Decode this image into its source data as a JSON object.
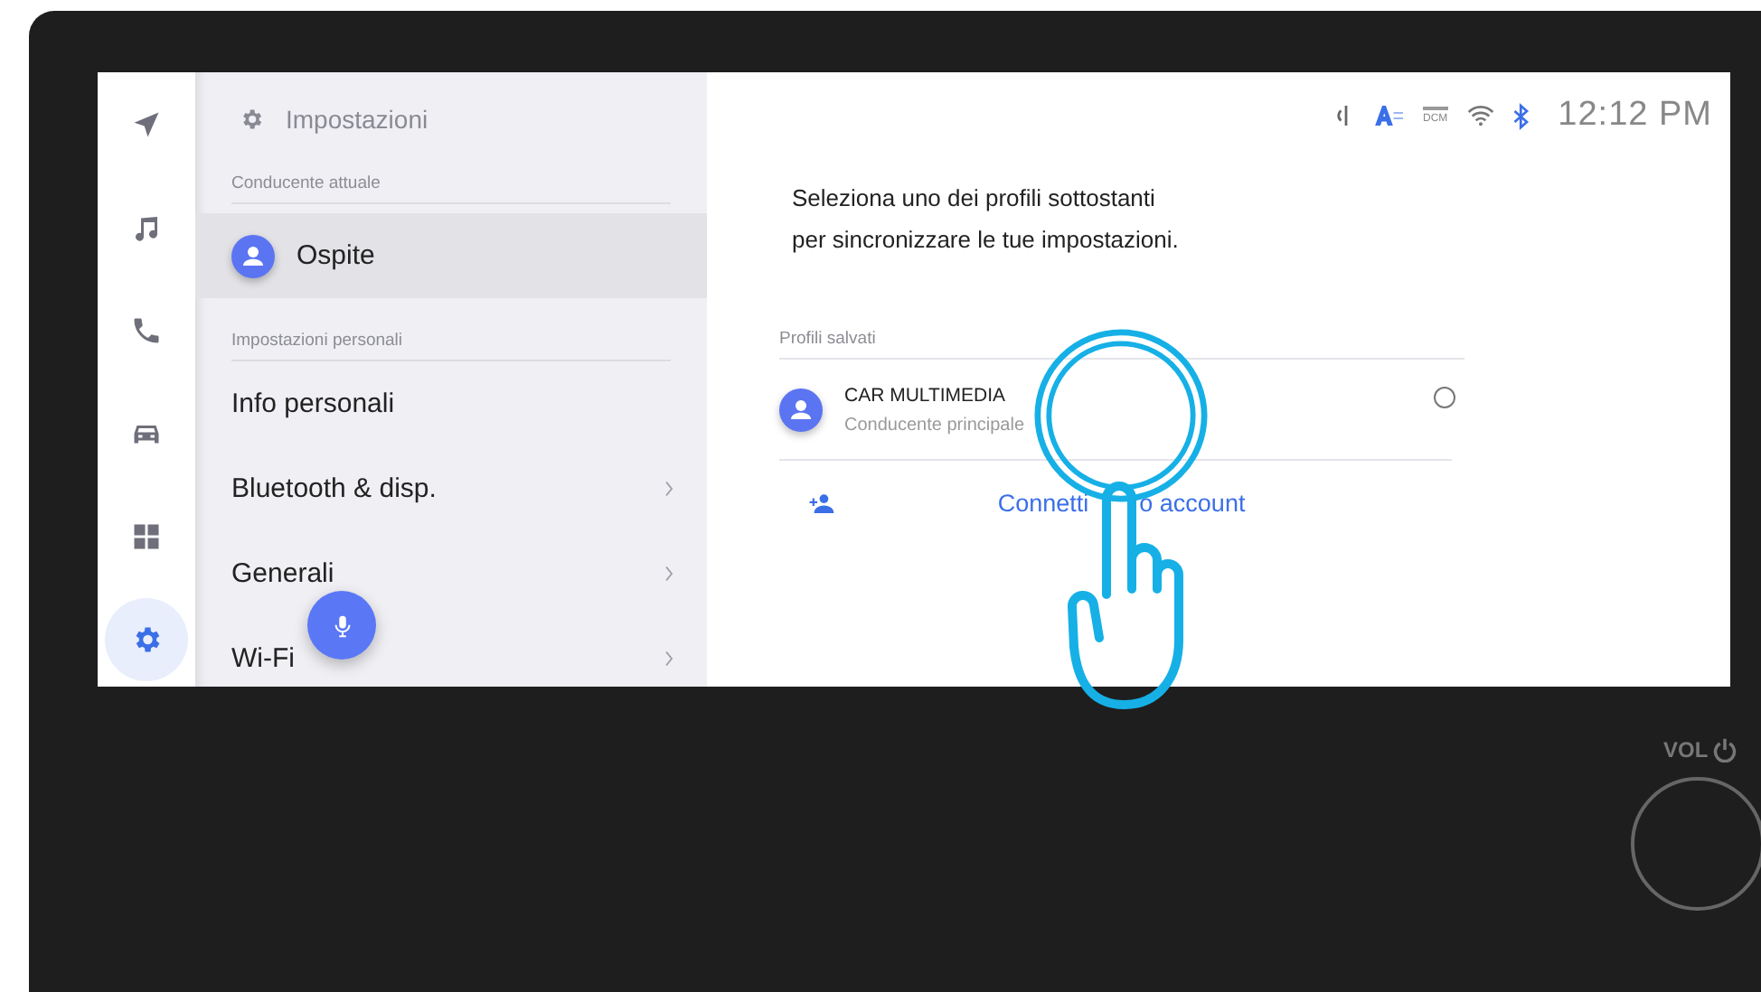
{
  "rail": [
    {
      "kind": "navigation",
      "selected": false
    },
    {
      "kind": "music",
      "selected": false
    },
    {
      "kind": "phone",
      "selected": false
    },
    {
      "kind": "car",
      "selected": false
    },
    {
      "kind": "apps",
      "selected": false
    },
    {
      "kind": "settings",
      "selected": true
    }
  ],
  "menu": {
    "title": "Impostazioni",
    "sections": [
      {
        "heading": "Conducente attuale",
        "items": [
          {
            "kind": "profile",
            "label": "Ospite",
            "selected": true,
            "chevron": false
          }
        ]
      },
      {
        "heading": "Impostazioni personali",
        "items": [
          {
            "kind": "link",
            "label": "Info personali",
            "selected": false,
            "chevron": false
          },
          {
            "kind": "link",
            "label": "Bluetooth & disp.",
            "selected": false,
            "chevron": true
          },
          {
            "kind": "link",
            "label": "Generali",
            "selected": false,
            "chevron": true
          },
          {
            "kind": "link",
            "label": "Wi-Fi",
            "selected": false,
            "chevron": true
          }
        ]
      }
    ]
  },
  "status_bar": {
    "icons": [
      {
        "kind": "wireless-charging"
      },
      {
        "kind": "text-size"
      },
      {
        "kind": "dcm",
        "label": "DCM"
      },
      {
        "kind": "wifi"
      },
      {
        "kind": "bluetooth"
      }
    ],
    "time": "12:12 PM"
  },
  "content": {
    "intro": [
      "Seleziona uno dei profili sottostanti",
      "per sincronizzare le tue impostazioni."
    ],
    "saved_heading": "Profili salvati",
    "profiles": [
      {
        "name": "CAR MULTIMEDIA",
        "role": "Conducente principale",
        "selected": false
      }
    ],
    "add_account": [
      "Connetti",
      "o account"
    ]
  },
  "knob": {
    "label": "VOL"
  }
}
